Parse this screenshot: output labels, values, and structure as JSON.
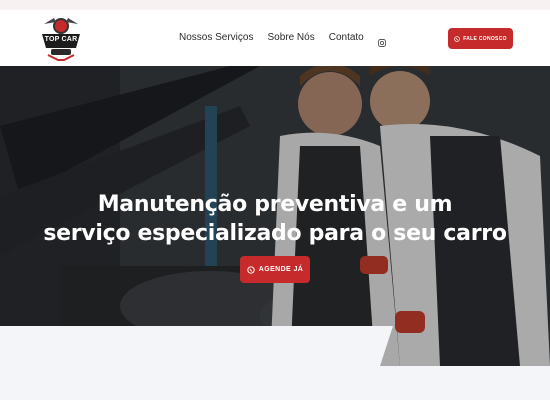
{
  "brand": {
    "logo_text": "TOP CAR"
  },
  "nav": {
    "items": [
      {
        "label": "Nossos Serviços"
      },
      {
        "label": "Sobre Nós"
      },
      {
        "label": "Contato"
      }
    ],
    "social_icon": "instagram-icon"
  },
  "header_cta": {
    "label": "FALE CONOSCO",
    "icon": "whatsapp-icon"
  },
  "hero": {
    "title_line1": "Manutenção preventiva e um",
    "title_line2": "serviço especializado para o seu carro",
    "cta_label": "AGENDE JÁ",
    "cta_icon": "whatsapp-icon"
  },
  "colors": {
    "accent": "#c62a2a",
    "header_bg": "#ffffff",
    "section_bg": "#f4f5f8"
  }
}
